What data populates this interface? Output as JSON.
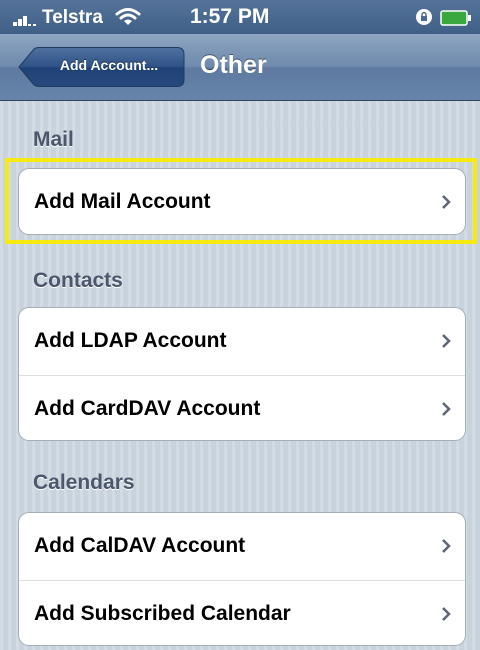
{
  "status_bar": {
    "carrier": "Telstra",
    "time": "1:57 PM",
    "signal_icon": "signal-bars-icon",
    "wifi_icon": "wifi-icon",
    "lock_icon": "rotation-lock-icon",
    "battery_icon": "battery-icon"
  },
  "nav_bar": {
    "back_label": "Add Account...",
    "title": "Other"
  },
  "sections": [
    {
      "header": "Mail",
      "items": [
        {
          "label": "Add Mail Account"
        }
      ]
    },
    {
      "header": "Contacts",
      "items": [
        {
          "label": "Add LDAP Account"
        },
        {
          "label": "Add CardDAV Account"
        }
      ]
    },
    {
      "header": "Calendars",
      "items": [
        {
          "label": "Add CalDAV Account"
        },
        {
          "label": "Add Subscribed Calendar"
        }
      ]
    }
  ],
  "colors": {
    "highlight": "#f7ea10",
    "nav_bar": "#6e89ad",
    "background": "#c9d3dd"
  }
}
